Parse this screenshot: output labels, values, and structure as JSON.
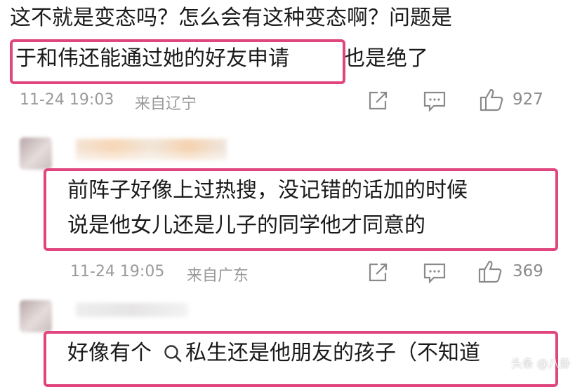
{
  "comments": [
    {
      "lines": [
        "这不就是变态吗？怎么会有这种变态啊？问题是",
        "于和伟还能通过她的好友申请",
        "也是绝了"
      ],
      "time": "11-24 19:03",
      "location": "来自辽宁",
      "likes": "927"
    },
    {
      "lines": [
        "前阵子好像上过热搜，没记错的话加的时候",
        "说是他女儿还是儿子的同学他才同意的"
      ],
      "time": "11-24 19:05",
      "location": "来自广东",
      "likes": "369"
    },
    {
      "lines": [
        "好像有个",
        "私生还是他朋友的孩子（不知道"
      ]
    }
  ],
  "icons": {
    "share": "share-icon",
    "reply": "comment-icon",
    "like": "thumbs-up-icon",
    "search": "search-icon"
  },
  "colors": {
    "highlight": "#e0457e",
    "meta": "#9a9a9a"
  },
  "watermark": "头条 @八卦"
}
